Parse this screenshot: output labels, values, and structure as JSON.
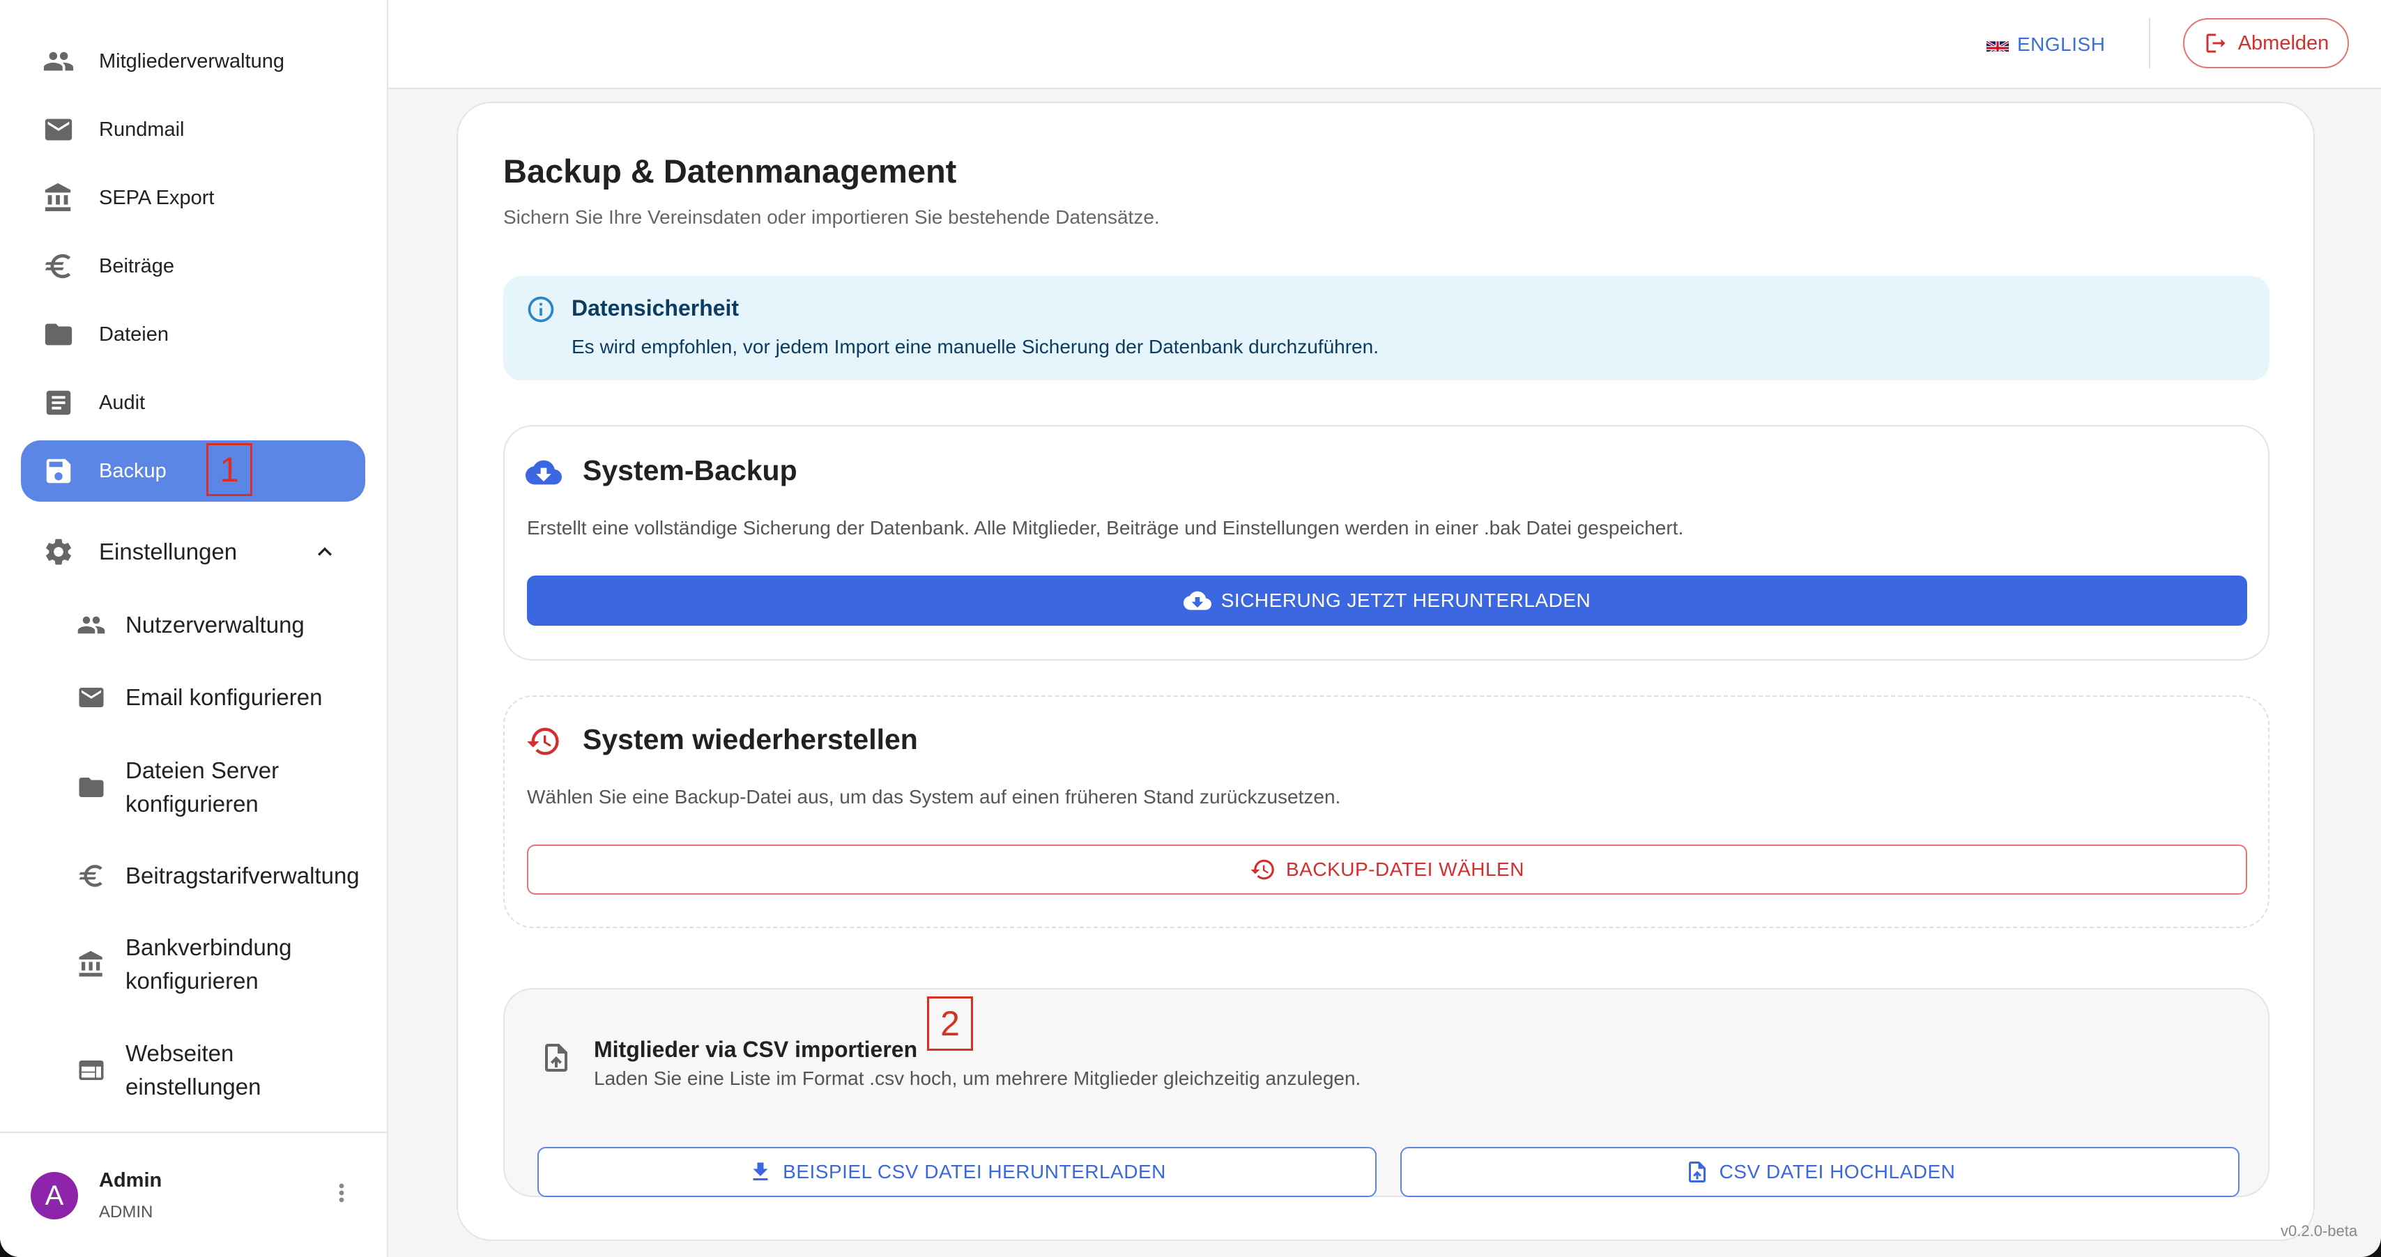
{
  "sidebar": {
    "items": [
      {
        "label": "Mitgliederverwaltung",
        "icon": "people-icon"
      },
      {
        "label": "Rundmail",
        "icon": "mail-icon"
      },
      {
        "label": "SEPA Export",
        "icon": "bank-icon"
      },
      {
        "label": "Beiträge",
        "icon": "euro-icon"
      },
      {
        "label": "Dateien",
        "icon": "folder-icon"
      },
      {
        "label": "Audit",
        "icon": "document-icon"
      },
      {
        "label": "Backup",
        "icon": "save-icon",
        "active": true
      }
    ],
    "settings": {
      "label": "Einstellungen",
      "expanded": true,
      "subitems": [
        {
          "label": "Nutzerverwaltung",
          "icon": "people-icon"
        },
        {
          "label": "Email konfigurieren",
          "icon": "mail-icon"
        },
        {
          "label": "Dateien Server konfigurieren",
          "icon": "folder-icon"
        },
        {
          "label": "Beitragstarifverwaltung",
          "icon": "euro-icon"
        },
        {
          "label": "Bankverbindung konfigurieren",
          "icon": "bank-icon"
        },
        {
          "label": "Webseiten einstellungen",
          "icon": "web-icon"
        }
      ]
    },
    "user": {
      "initial": "A",
      "name": "Admin",
      "role": "ADMIN"
    }
  },
  "markers": [
    "1",
    "2"
  ],
  "topbar": {
    "language": "ENGLISH",
    "logout": "Abmelden"
  },
  "main": {
    "title": "Backup & Datenmanagement",
    "subtitle": "Sichern Sie Ihre Vereinsdaten oder importieren Sie bestehende Datensätze.",
    "alert": {
      "title": "Datensicherheit",
      "text": "Es wird empfohlen, vor jedem Import eine manuelle Sicherung der Datenbank durchzuführen."
    },
    "backup": {
      "title": "System-Backup",
      "desc": "Erstellt eine vollständige Sicherung der Datenbank. Alle Mitglieder, Beiträge und Einstellungen werden in einer .bak Datei gespeichert.",
      "button": "SICHERUNG JETZT HERUNTERLADEN"
    },
    "restore": {
      "title": "System wiederherstellen",
      "desc": "Wählen Sie eine Backup-Datei aus, um das System auf einen früheren Stand zurückzusetzen.",
      "button": "BACKUP-DATEI WÄHLEN"
    },
    "csv": {
      "title": "Mitglieder via CSV importieren",
      "desc": "Laden Sie eine Liste im Format .csv hoch, um mehrere Mitglieder gleichzeitig anzulegen.",
      "download_button": "BEISPIEL CSV DATEI HERUNTERLADEN",
      "upload_button": "CSV DATEI HOCHLADEN"
    }
  },
  "version": "v0.2.0-beta",
  "colors": {
    "primary": "#3b67e0",
    "active_nav": "#5b86e5",
    "danger": "#d32f2f",
    "info_bg": "#e6f4fb"
  }
}
